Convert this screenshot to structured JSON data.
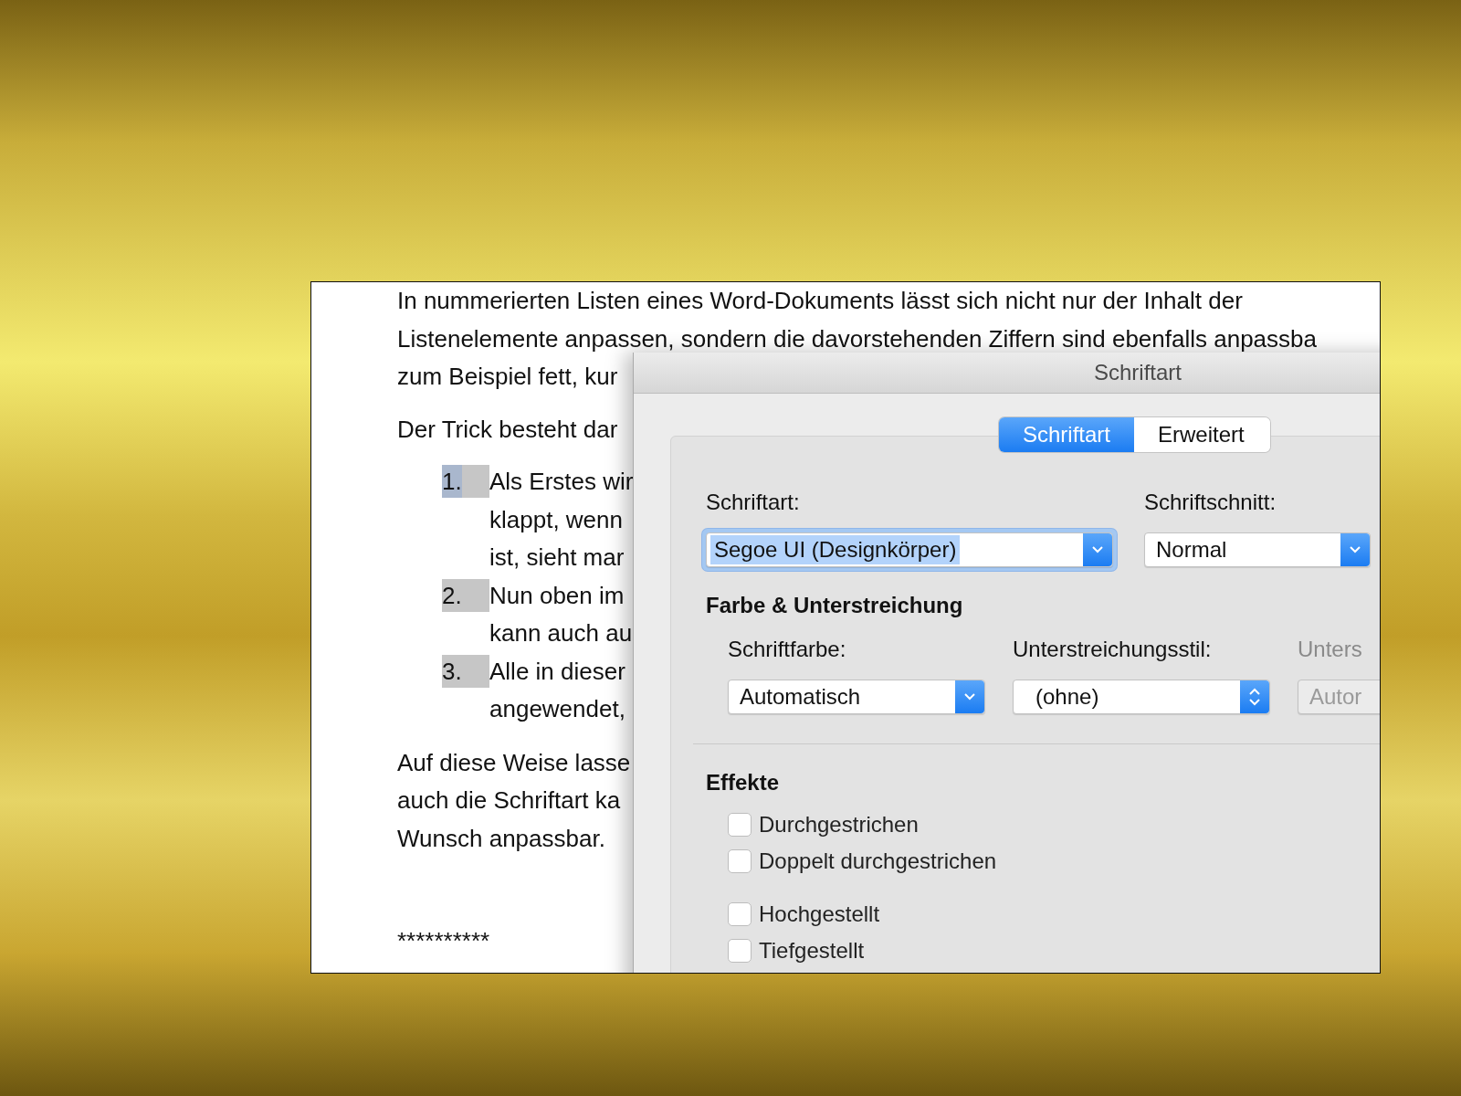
{
  "document": {
    "intro": [
      "In nummerierten Listen eines Word-Dokuments lässt sich nicht nur der Inhalt der",
      "Listenelemente anpassen, sondern die davorstehenden Ziffern sind ebenfalls anpassba",
      "zum Beispiel fett, kur"
    ],
    "lead": [
      "Der Trick besteht dar"
    ],
    "list": [
      {
        "number": "1.",
        "selected": true,
        "lines": [
          "Als Erstes wir",
          "klappt, wenn",
          "ist, sieht mar"
        ]
      },
      {
        "number": "2.",
        "selected": false,
        "lines": [
          "Nun oben im",
          "kann auch au"
        ]
      },
      {
        "number": "3.",
        "selected": false,
        "lines": [
          "Alle in dieser",
          "angewendet,"
        ]
      }
    ],
    "outro": [
      "Auf diese Weise lasse",
      "auch die Schriftart ka",
      "Wunsch anpassbar."
    ],
    "separator": "**********"
  },
  "dialog": {
    "title": "Schriftart",
    "tabs": [
      {
        "label": "Schriftart",
        "selected": true
      },
      {
        "label": "Erweitert",
        "selected": false
      }
    ],
    "font": {
      "label": "Schriftart:",
      "value": "Segoe UI (Designkörper)",
      "focused": true,
      "text_selected": true
    },
    "style": {
      "label": "Schriftschnitt:",
      "value": "Normal"
    },
    "color_heading": "Farbe & Unterstreichung",
    "color_fields": [
      {
        "label": "Schriftfarbe:",
        "value": "Automatisch",
        "kind": "popup",
        "disabled": false
      },
      {
        "label": "Unterstreichungsstil:",
        "value": "(ohne)",
        "kind": "stepper",
        "disabled": false
      },
      {
        "label": "Unters",
        "value": "Autor",
        "kind": "popup",
        "disabled": true
      }
    ],
    "effects_heading": "Effekte",
    "effects": [
      [
        {
          "label": "Durchgestrichen",
          "checked": false
        },
        {
          "label": "Doppelt durchgestrichen",
          "checked": false
        }
      ],
      [
        {
          "label": "Hochgestellt",
          "checked": false
        },
        {
          "label": "Tiefgestellt",
          "checked": false
        }
      ]
    ]
  }
}
